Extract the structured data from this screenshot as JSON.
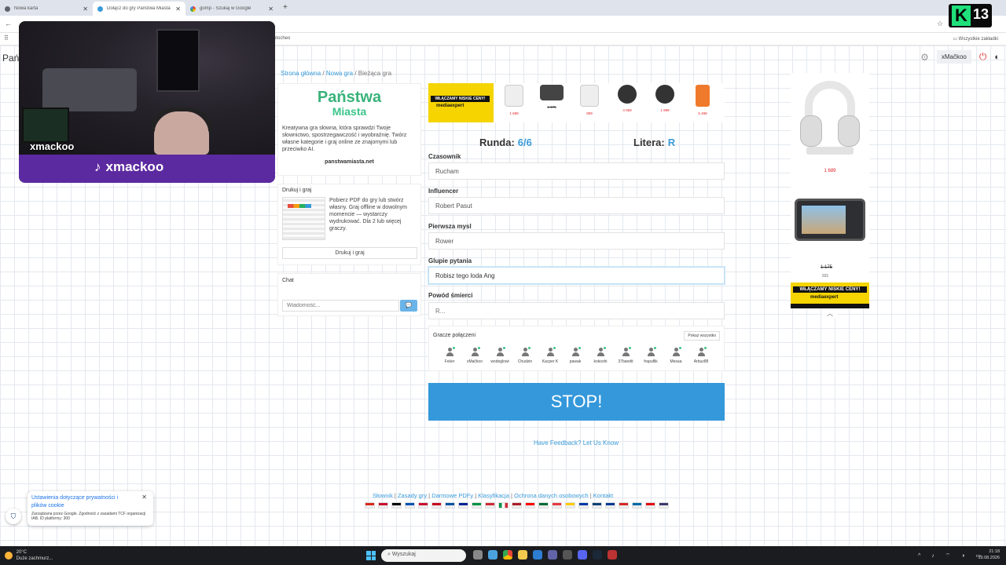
{
  "browser": {
    "tabs": [
      {
        "label": "Nowa karta",
        "active": false
      },
      {
        "label": "Dołącz do gry Państwa Miasta",
        "active": true
      },
      {
        "label": "gomp - Szukaj w Google",
        "active": false
      }
    ],
    "bookmarks_right": "Wszystkie zakładki",
    "bookmarks_left_fragment": "otocheo"
  },
  "header": {
    "title_fragment": "Pań",
    "user": "xMačkoo"
  },
  "breadcrumb": {
    "home": "Strona główna",
    "new_game": "Nowa gra",
    "current": "Bieżąca gra"
  },
  "logo_card": {
    "logo_line1": "Państwa",
    "logo_line2": "Miasta",
    "description": "Kreatywna gra słowna, która sprawdzi Twoje słownictwo, spostrzegawczość i wyobraźnię. Twórz własne kategorie i graj online ze znajomymi lub przeciwko AI.",
    "site": "panstwamiasta.net"
  },
  "print_card": {
    "title": "Drukuj i graj",
    "text": "Pobierz PDF do gry lub stwórz własny. Graj offline w dowolnym momencie — wystarczy wydrukować. Dla 2 lub więcej graczy.",
    "button": "Drukuj i graj"
  },
  "chat": {
    "title": "Chat",
    "placeholder": "Wiadomość..."
  },
  "ad_top": {
    "slogan": "WŁĄCZAMY NISKIE CENY!",
    "brand": "mediaexpert",
    "prices": [
      "1 689",
      "1 175",
      "809",
      "4 069",
      "1 999",
      "5 499"
    ]
  },
  "game": {
    "round_label": "Runda:",
    "round_value": "6/6",
    "letter_label": "Litera:",
    "letter_value": "R",
    "fields": [
      {
        "label": "Czasownik",
        "value": "Rucham",
        "placeholder": ""
      },
      {
        "label": "Influencer",
        "value": "Robert Pasut",
        "placeholder": ""
      },
      {
        "label": "Pierwsza mysl",
        "value": "Rower",
        "placeholder": ""
      },
      {
        "label": "Glupie pytania",
        "value": "Robisz tego loda Ang",
        "placeholder": ""
      },
      {
        "label": "Powód śmierci",
        "value": "",
        "placeholder": "R..."
      }
    ],
    "stop_button": "STOP!"
  },
  "players": {
    "title": "Gracze połączeni",
    "show_all": "Pokaż wszystko",
    "list": [
      "Foker",
      "xMačkoo",
      "wodoglowi",
      "Chudzin",
      "Kacper K",
      "pawak",
      "kokoshi",
      "37bandit",
      "frapuflik",
      "Mesaa",
      "Arbuz88"
    ]
  },
  "feedback": "Have Feedback? Let Us Know",
  "footer": {
    "links": [
      "Słownik",
      "Zasady gry",
      "Darmowe PDFy",
      "Klasyfikacja",
      "Ochrona danych osobowych",
      "Kontakt"
    ],
    "flag_colors": [
      "#d52b1e",
      "#c8102e",
      "#000000",
      "#0052b4",
      "#c8102e",
      "#c60b1e",
      "#0055a4",
      "#002395",
      "#009246",
      "#ce2b37",
      "#ffffff",
      "#ae1c28",
      "#ff0000",
      "#046a38",
      "#e63946",
      "#ffcc00",
      "#0039a6",
      "#0c4076",
      "#003893",
      "#d62828",
      "#006aa7",
      "#e30a17",
      "#3c3b6e"
    ]
  },
  "ad_right": {
    "price1": "1 689",
    "old_price": "1 175",
    "new_price": "931",
    "slogan": "WŁĄCZAMY NISKIE CENY!",
    "brand": "mediaexpert"
  },
  "cookie": {
    "title": "Ustawienia dotyczące prywatności i plików cookie",
    "subtitle": "Zarządzana przez Google. Zgodność z zasadami TCF organizacji IAB. ID platformy: 300"
  },
  "webcam": {
    "name": "xmackoo",
    "tiktok_name": "xmackoo"
  },
  "channel_logo": {
    "letter": "K",
    "number": "13"
  },
  "taskbar": {
    "temp": "20°C",
    "weather": "Duże zachmurz...",
    "search": "Wyszukaj",
    "time": "21:18",
    "date": "19.08.2026"
  }
}
